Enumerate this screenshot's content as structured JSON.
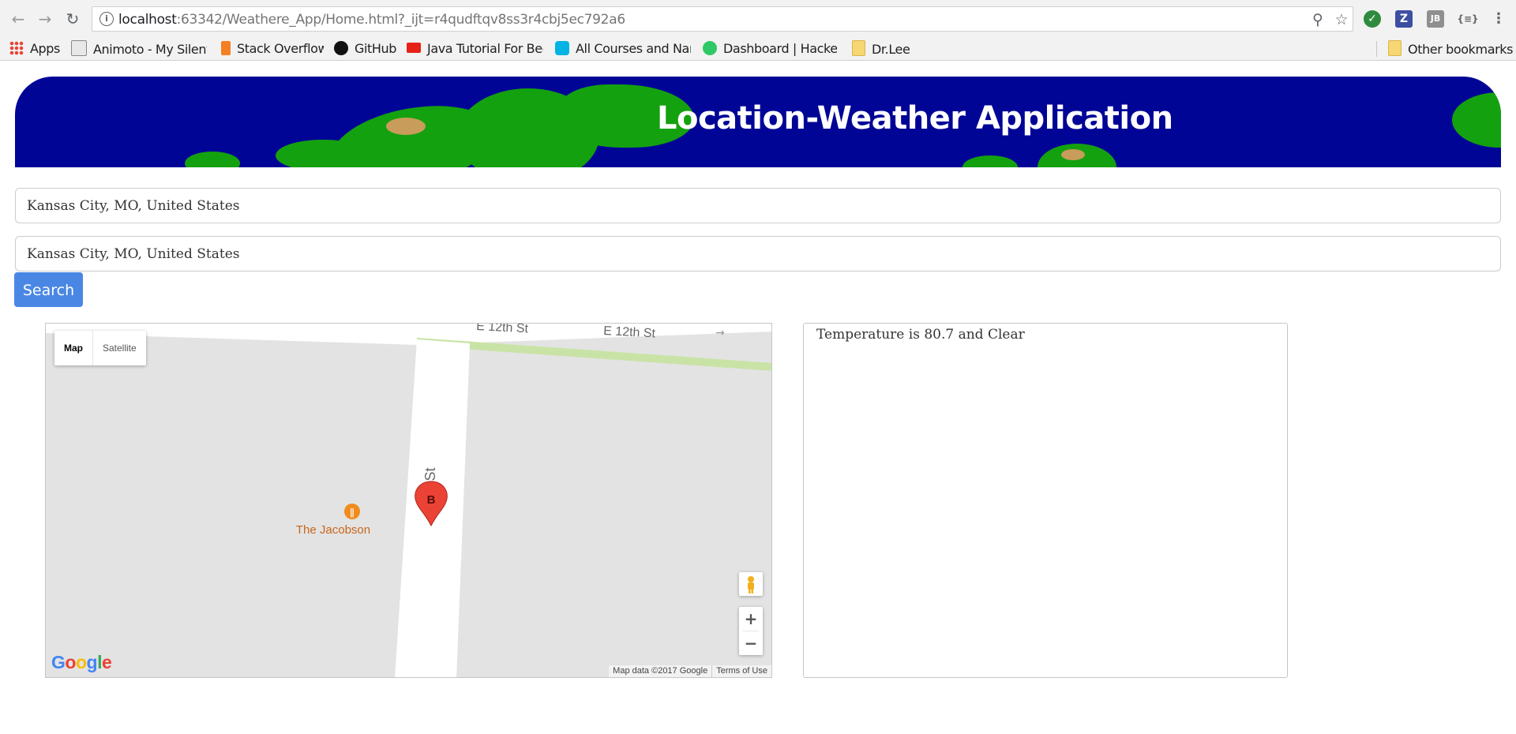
{
  "browser": {
    "url_host": "localhost",
    "url_rest": ":63342/Weathere_App/Home.html?_ijt=r4qudftqv8ss3r4cbj5ec792a6",
    "bookmarks": [
      {
        "label": "Apps",
        "icon": "apps-grid-icon"
      },
      {
        "label": "Animoto - My Silent I",
        "icon": "animoto-icon"
      },
      {
        "label": "Stack Overflow",
        "icon": "stackoverflow-icon"
      },
      {
        "label": "GitHub",
        "icon": "github-icon"
      },
      {
        "label": "Java Tutorial For Begi",
        "icon": "youtube-icon"
      },
      {
        "label": "All Courses and Nanc",
        "icon": "udacity-icon"
      },
      {
        "label": "Dashboard | HackerR",
        "icon": "hackerrank-icon"
      },
      {
        "label": "Dr.Lee",
        "icon": "folder-icon"
      }
    ],
    "other_bookmarks": "Other bookmarks"
  },
  "page": {
    "title": "Location-Weather Application",
    "origin_value": "Kansas City, MO, United States",
    "destination_value": "Kansas City, MO, United States",
    "search_label": "Search"
  },
  "map": {
    "type_map": "Map",
    "type_satellite": "Satellite",
    "street_1": "E 12th St",
    "street_2": "E 12th St",
    "street_oak": "Oak St",
    "poi": "The Jacobson",
    "marker": "B",
    "zoom_in": "+",
    "zoom_out": "−",
    "logo": "Google",
    "attribution": "Map data ©2017 Google",
    "terms": "Terms of Use"
  },
  "weather": {
    "text": "Temperature is 80.7 and Clear"
  }
}
